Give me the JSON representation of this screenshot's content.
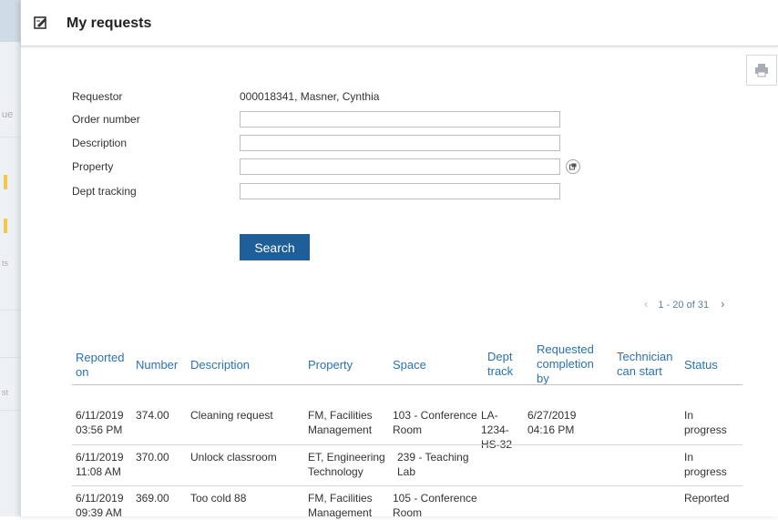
{
  "window": {
    "title": "My requests"
  },
  "background": {
    "fragment_1": "ue",
    "fragment_2": "ts",
    "fragment_3": "st"
  },
  "form": {
    "requestor_label": "Requestor",
    "requestor_value": "000018341, Masner, Cynthia",
    "order_number_label": "Order number",
    "order_number_value": "",
    "description_label": "Description",
    "description_value": "",
    "property_label": "Property",
    "property_value": "",
    "dept_tracking_label": "Dept tracking",
    "dept_tracking_value": "",
    "search_label": "Search"
  },
  "pager": {
    "prev": "‹",
    "range": "1 - 20 of 31",
    "next": "›"
  },
  "table": {
    "headers": {
      "reported_on": "Reported on",
      "number": "Number",
      "description": "Description",
      "property": "Property",
      "space": "Space",
      "dept_track": "Dept track",
      "requested_completion": "Requested completion by",
      "technician": "Technician can start",
      "status": "Status"
    },
    "rows": [
      {
        "reported_on": "6/11/2019 03:56 PM",
        "number": "374.00",
        "description": "Cleaning request",
        "property": "FM, Facilities Management",
        "space": "103 - Conference Room",
        "dept_track": "LA-1234- HS-32",
        "requested_completion": "6/27/2019 04:16 PM",
        "technician": "",
        "status": "In progress"
      },
      {
        "reported_on": "6/11/2019 11:08 AM",
        "number": "370.00",
        "description": "Unlock classroom",
        "property": "ET, Engineering Technology",
        "space": "239 - Teaching Lab",
        "dept_track": "",
        "requested_completion": "",
        "technician": "",
        "status": "In progress"
      },
      {
        "reported_on": "6/11/2019 09:39 AM",
        "number": "369.00",
        "description": "Too cold 88",
        "property": "FM, Facilities Management",
        "space": "105 - Conference Room",
        "dept_track": "",
        "requested_completion": "",
        "technician": "",
        "status": "Reported"
      }
    ]
  }
}
